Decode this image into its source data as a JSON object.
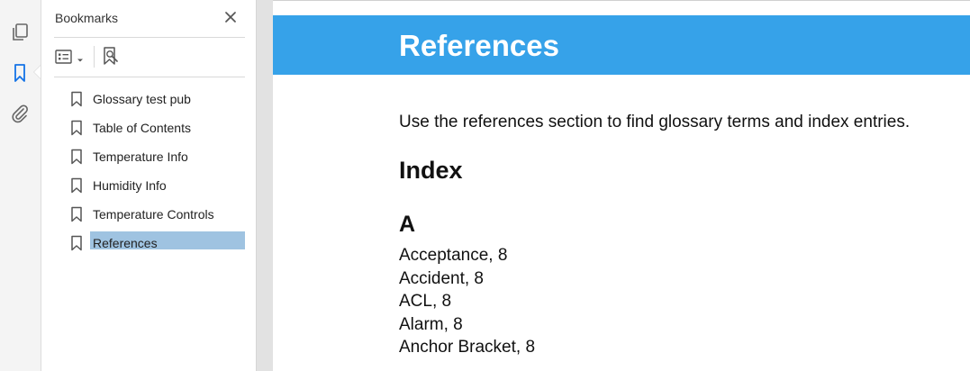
{
  "rail": {
    "items": [
      {
        "name": "pages-icon"
      },
      {
        "name": "bookmark-icon",
        "active": true
      },
      {
        "name": "attachment-icon"
      }
    ]
  },
  "bookmarks_panel": {
    "title": "Bookmarks",
    "close_icon": "close-icon",
    "toolbar": [
      "options-menu-icon",
      "bookmark-search-icon"
    ],
    "items": [
      {
        "label": "Glossary test pub"
      },
      {
        "label": "Table of Contents"
      },
      {
        "label": "Temperature Info"
      },
      {
        "label": "Humidity Info"
      },
      {
        "label": "Temperature Controls"
      },
      {
        "label": "References",
        "selected": true
      }
    ]
  },
  "document": {
    "banner_title": "References",
    "intro": "Use the references section to find glossary terms and index entries.",
    "index_heading": "Index",
    "letter": "A",
    "entries": [
      "Acceptance, 8",
      "Accident, 8",
      "ACL, 8",
      "Alarm, 8",
      "Anchor Bracket, 8"
    ]
  },
  "colors": {
    "banner": "#36a2e9",
    "selection": "#9fc3e1",
    "accent_icon": "#1473e6"
  }
}
